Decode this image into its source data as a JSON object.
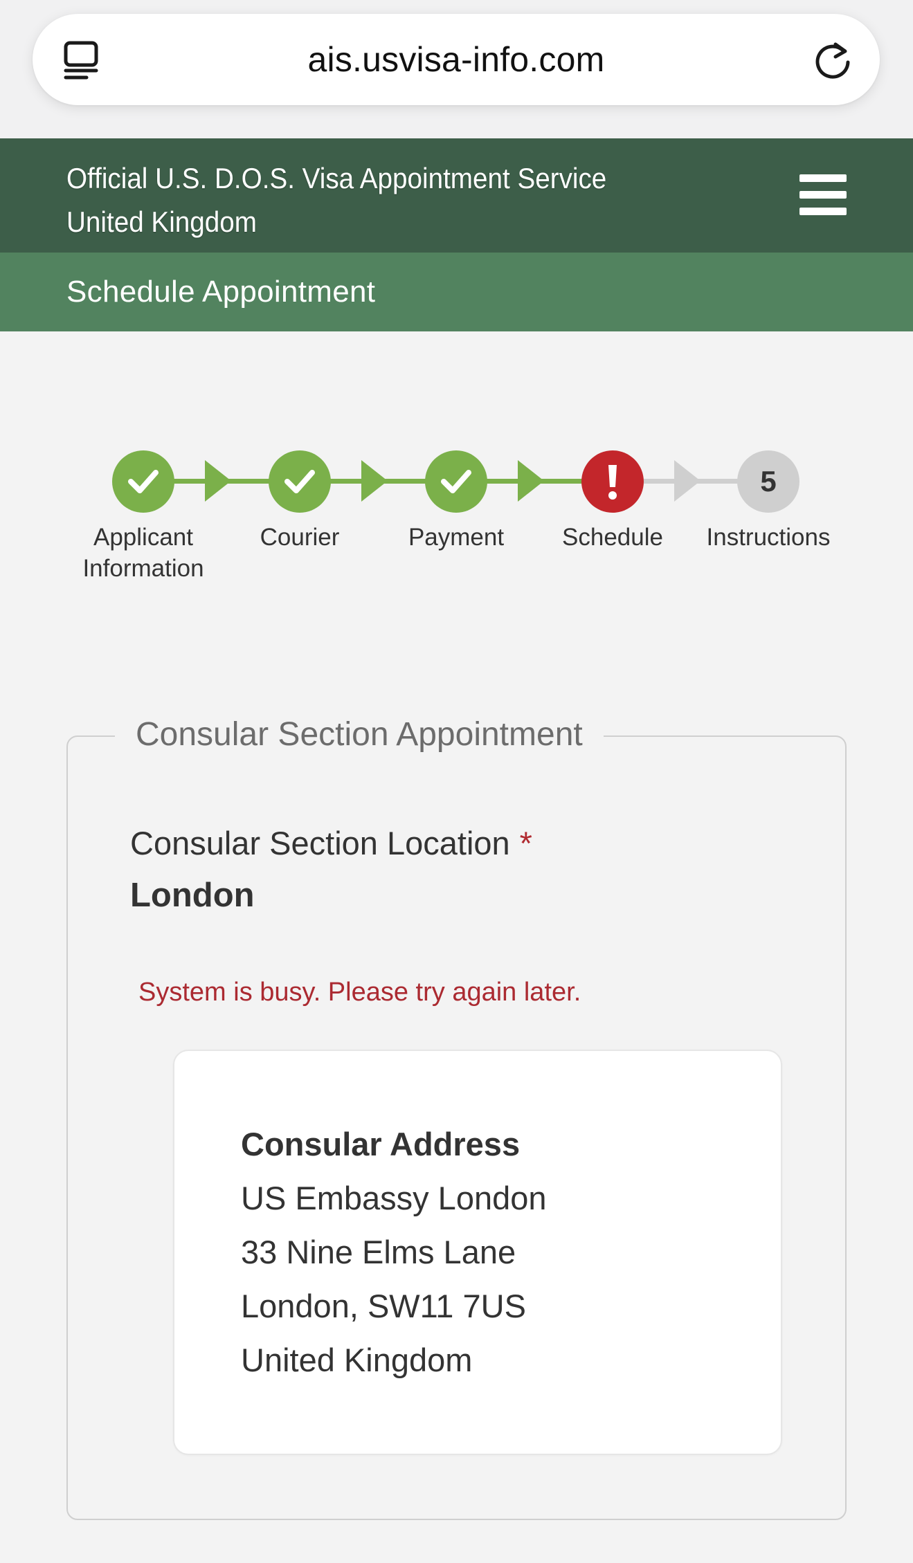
{
  "browser": {
    "url": "ais.usvisa-info.com",
    "tabs_icon": "tabs-icon",
    "reload_icon": "reload-icon"
  },
  "header": {
    "title_line1": "Official U.S. D.O.S. Visa Appointment Service",
    "title_line2": "United Kingdom",
    "menu_icon": "hamburger-menu-icon"
  },
  "subheader": {
    "title": "Schedule Appointment"
  },
  "steps": [
    {
      "label_line1": "Applicant",
      "label_line2": "Information",
      "status": "complete",
      "icon": "checkmark-icon"
    },
    {
      "label_line1": "Courier",
      "label_line2": "",
      "status": "complete",
      "icon": "checkmark-icon"
    },
    {
      "label_line1": "Payment",
      "label_line2": "",
      "status": "complete",
      "icon": "checkmark-icon"
    },
    {
      "label_line1": "Schedule",
      "label_line2": "",
      "status": "error",
      "icon": "exclamation-icon"
    },
    {
      "label_line1": "Instructions",
      "label_line2": "",
      "status": "pending",
      "number": "5"
    }
  ],
  "appointment": {
    "legend": "Consular Section Appointment",
    "location_label": "Consular Section Location",
    "required_marker": "*",
    "location_value": "London",
    "error_message": "System is busy. Please try again later.",
    "address": {
      "heading": "Consular Address",
      "line1": "US Embassy London",
      "line2": "33 Nine Elms Lane",
      "line3": "London, SW11 7US",
      "line4": "United Kingdom"
    }
  },
  "colors": {
    "header_bg": "#3d5e49",
    "subheader_bg": "#52835f",
    "step_complete": "#7bb04a",
    "step_error": "#c3262b",
    "step_pending": "#cfcfcf",
    "error_text": "#ab2a31"
  }
}
